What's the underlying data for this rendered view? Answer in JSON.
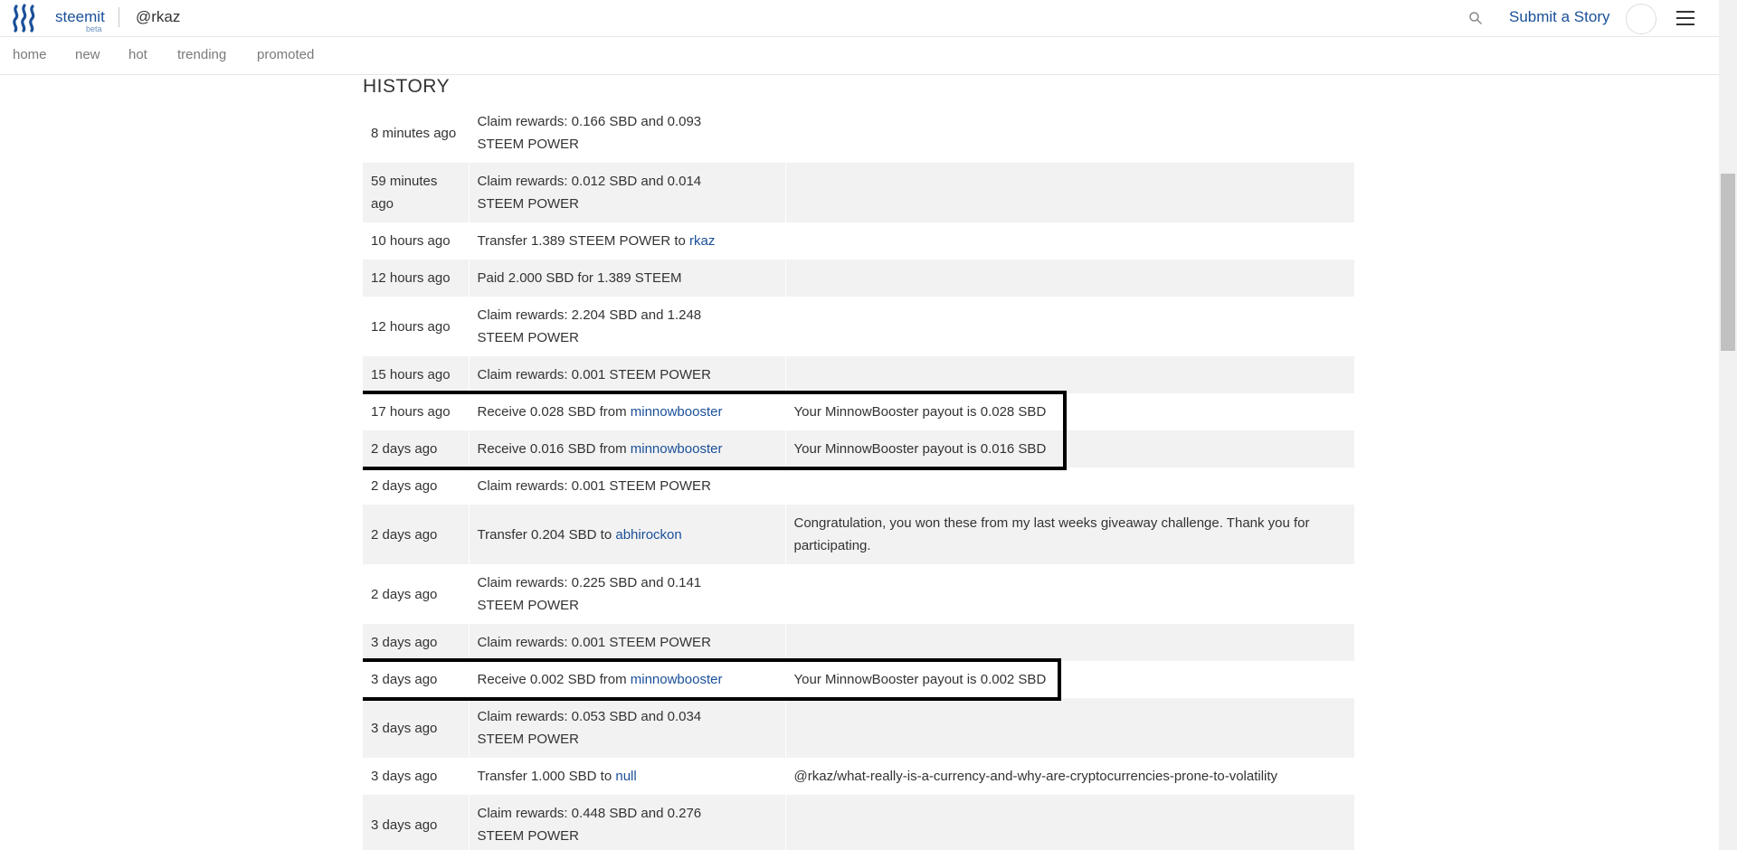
{
  "header": {
    "brand": "steemit",
    "beta": "beta",
    "user": "@rkaz",
    "submit": "Submit a Story"
  },
  "nav": {
    "items": [
      "home",
      "new",
      "hot",
      "trending",
      "promoted"
    ]
  },
  "history": {
    "title": "HISTORY",
    "rows": [
      {
        "time": "8 minutes ago",
        "op": "Claim rewards: 0.166 SBD and 0.093 STEEM POWER",
        "memo": ""
      },
      {
        "time": "59 minutes ago",
        "op": "Claim rewards: 0.012 SBD and 0.014 STEEM POWER",
        "memo": ""
      },
      {
        "time": "10 hours ago",
        "op_prefix": "Transfer 1.389 STEEM POWER to ",
        "link": "rkaz",
        "memo": ""
      },
      {
        "time": "12 hours ago",
        "op": "Paid 2.000 SBD for 1.389 STEEM",
        "memo": ""
      },
      {
        "time": "12 hours ago",
        "op": "Claim rewards: 2.204 SBD and 1.248 STEEM POWER",
        "memo": ""
      },
      {
        "time": "15 hours ago",
        "op": "Claim rewards: 0.001 STEEM POWER",
        "memo": ""
      },
      {
        "time": "17 hours ago",
        "op_prefix": "Receive 0.028 SBD from ",
        "link": "minnowbooster",
        "memo": "Your MinnowBooster payout is 0.028 SBD"
      },
      {
        "time": "2 days ago",
        "op_prefix": "Receive 0.016 SBD from ",
        "link": "minnowbooster",
        "memo": "Your MinnowBooster payout is 0.016 SBD"
      },
      {
        "time": "2 days ago",
        "op": "Claim rewards: 0.001 STEEM POWER",
        "memo": ""
      },
      {
        "time": "2 days ago",
        "op_prefix": "Transfer 0.204 SBD to ",
        "link": "abhirockon",
        "memo": "Congratulation, you won these from my last weeks giveaway challenge. Thank you for participating."
      },
      {
        "time": "2 days ago",
        "op": "Claim rewards: 0.225 SBD and 0.141 STEEM POWER",
        "memo": ""
      },
      {
        "time": "3 days ago",
        "op": "Claim rewards: 0.001 STEEM POWER",
        "memo": ""
      },
      {
        "time": "3 days ago",
        "op_prefix": "Receive 0.002 SBD from ",
        "link": "minnowbooster",
        "memo": "Your MinnowBooster payout is 0.002 SBD"
      },
      {
        "time": "3 days ago",
        "op": "Claim rewards: 0.053 SBD and 0.034 STEEM POWER",
        "memo": ""
      },
      {
        "time": "3 days ago",
        "op_prefix": "Transfer 1.000 SBD to ",
        "link": "null",
        "memo": "@rkaz/what-really-is-a-currency-and-why-are-cryptocurrencies-prone-to-volatility"
      },
      {
        "time": "3 days ago",
        "op": "Claim rewards: 0.448 SBD and 0.276 STEEM POWER",
        "memo": ""
      }
    ]
  },
  "colors": {
    "brand": "#1a5099",
    "row_alt": "#f2f2f2",
    "highlight_border": "#000000"
  }
}
